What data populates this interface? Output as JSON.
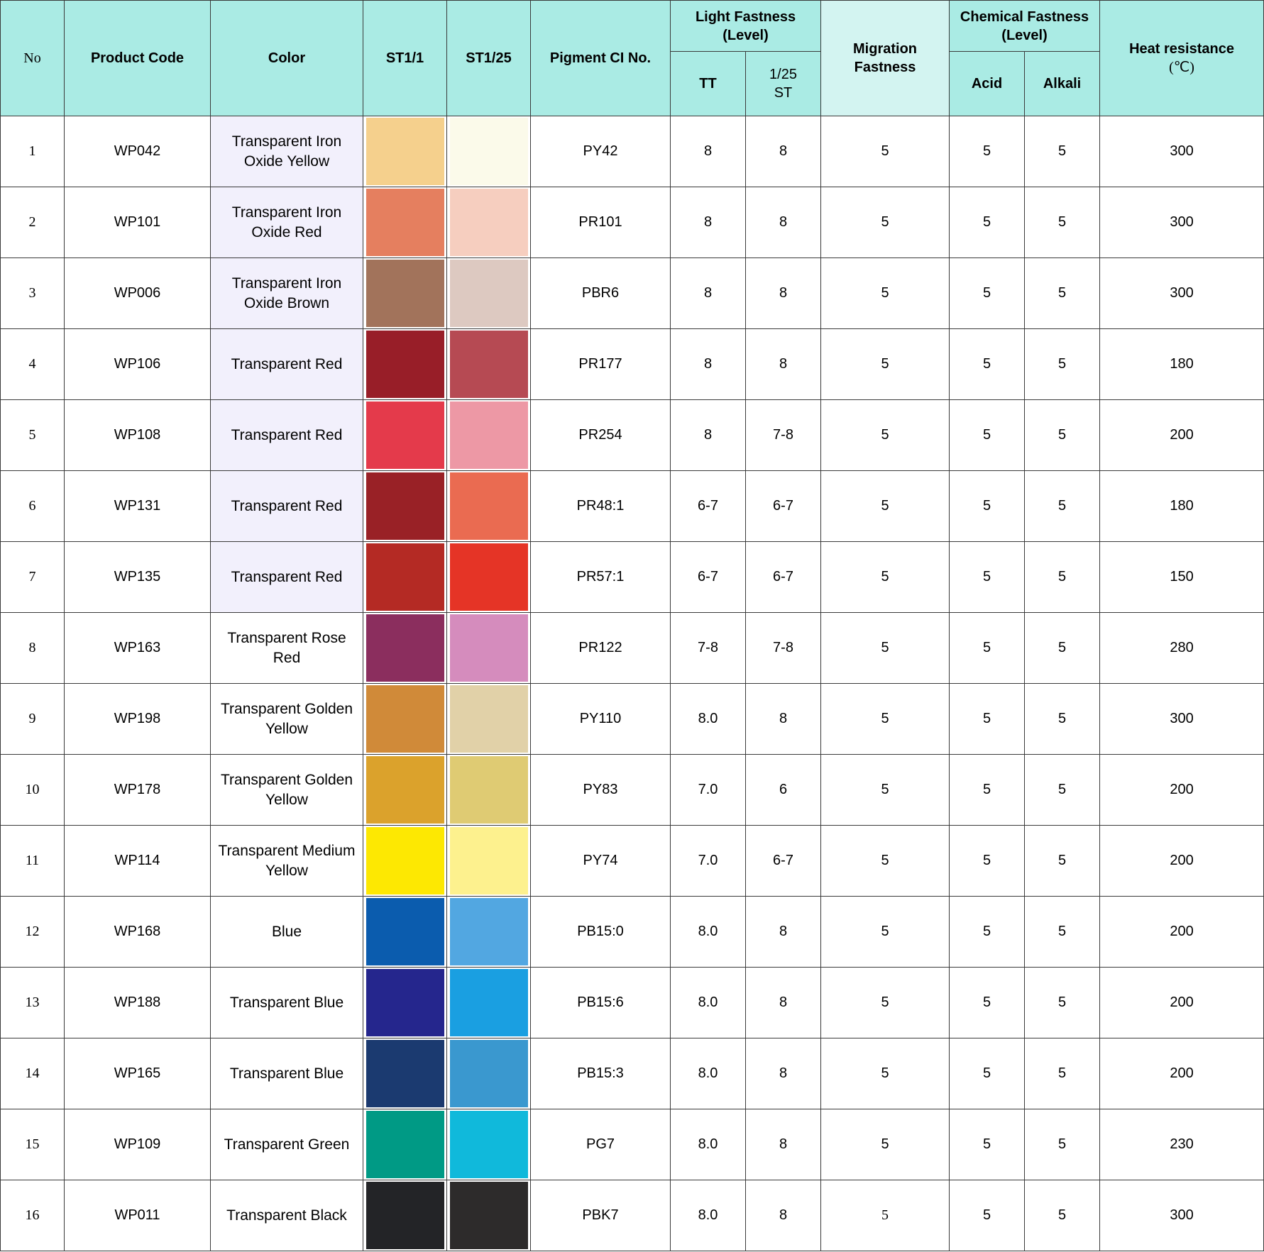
{
  "header": {
    "no": "No",
    "product_code": "Product Code",
    "color": "Color",
    "st1_1": "ST1/1",
    "st1_25": "ST1/25",
    "pigment_ci": "Pigment  CI No.",
    "light_fastness": [
      "Light Fastness",
      "(Level)"
    ],
    "tt": "TT",
    "st_125": [
      "1/25",
      "ST"
    ],
    "migration_fastness": [
      "Migration",
      "Fastness"
    ],
    "chemical_fastness": [
      "Chemical Fastness",
      "(Level)"
    ],
    "acid": "Acid",
    "alkali": "Alkali",
    "heat_resistance": [
      "Heat resistance",
      "(℃)"
    ]
  },
  "rows": [
    {
      "no": "1",
      "code": "WP042",
      "color": [
        "Transparent Iron",
        "Oxide Yellow"
      ],
      "swatch_full": "#f5d08d",
      "swatch_tint": "#fbfaea",
      "ci": "PY42",
      "tt": "8",
      "st": "8",
      "migration": "5",
      "acid": "5",
      "alkali": "5",
      "heat": "300"
    },
    {
      "no": "2",
      "code": "WP101",
      "color": [
        "Transparent Iron",
        "Oxide Red"
      ],
      "swatch_full": "#e57f5f",
      "swatch_tint": "#f6cebf",
      "ci": "PR101",
      "tt": "8",
      "st": "8",
      "migration": "5",
      "acid": "5",
      "alkali": "5",
      "heat": "300"
    },
    {
      "no": "3",
      "code": "WP006",
      "color": [
        "Transparent Iron",
        "Oxide Brown"
      ],
      "swatch_full": "#a2735b",
      "swatch_tint": "#ddc9c1",
      "ci": "PBR6",
      "tt": "8",
      "st": "8",
      "migration": "5",
      "acid": "5",
      "alkali": "5",
      "heat": "300"
    },
    {
      "no": "4",
      "code": "WP106",
      "color": [
        "Transparent Red"
      ],
      "swatch_full": "#981e28",
      "swatch_tint": "#b64a53",
      "ci": "PR177",
      "tt": "8",
      "st": "8",
      "migration": "5",
      "acid": "5",
      "alkali": "5",
      "heat": "180"
    },
    {
      "no": "5",
      "code": "WP108",
      "color": [
        "Transparent Red"
      ],
      "swatch_full": "#e43a4b",
      "swatch_tint": "#ed98a5",
      "ci": "PR254",
      "tt": "8",
      "st": "7-8",
      "migration": "5",
      "acid": "5",
      "alkali": "5",
      "heat": "200"
    },
    {
      "no": "6",
      "code": "WP131",
      "color": [
        "Transparent Red"
      ],
      "swatch_full": "#992126",
      "swatch_tint": "#ea6b51",
      "ci": "PR48:1",
      "tt": "6-7",
      "st": "6-7",
      "migration": "5",
      "acid": "5",
      "alkali": "5",
      "heat": "180"
    },
    {
      "no": "7",
      "code": "WP135",
      "color": [
        "Transparent Red"
      ],
      "swatch_full": "#b42a24",
      "swatch_tint": "#e53426",
      "ci": "PR57:1",
      "tt": "6-7",
      "st": "6-7",
      "migration": "5",
      "acid": "5",
      "alkali": "5",
      "heat": "150"
    },
    {
      "no": "8",
      "code": "WP163",
      "color": [
        "Transparent Rose",
        "Red"
      ],
      "swatch_full": "#8b2e5e",
      "swatch_tint": "#d58cbd",
      "ci": "PR122",
      "tt": "7-8",
      "st": "7-8",
      "migration": "5",
      "acid": "5",
      "alkali": "5",
      "heat": "280"
    },
    {
      "no": "9",
      "code": "WP198",
      "color": [
        "Transparent Golden",
        "Yellow"
      ],
      "swatch_full": "#d08a39",
      "swatch_tint": "#e1d1a8",
      "ci": "PY110",
      "tt": "8.0",
      "st": "8",
      "migration": "5",
      "acid": "5",
      "alkali": "5",
      "heat": "300"
    },
    {
      "no": "10",
      "code": "WP178",
      "color": [
        "Transparent Golden",
        "Yellow"
      ],
      "swatch_full": "#dba22c",
      "swatch_tint": "#dfcb73",
      "ci": "PY83",
      "tt": "7.0",
      "st": "6",
      "migration": "5",
      "acid": "5",
      "alkali": "5",
      "heat": "200"
    },
    {
      "no": "11",
      "code": "WP114",
      "color": [
        "Transparent Medium",
        "Yellow"
      ],
      "swatch_full": "#fde802",
      "swatch_tint": "#fdf18e",
      "ci": "PY74",
      "tt": "7.0",
      "st": "6-7",
      "migration": "5",
      "acid": "5",
      "alkali": "5",
      "heat": "200"
    },
    {
      "no": "12",
      "code": "WP168",
      "color": [
        "Blue"
      ],
      "swatch_full": "#0b5cae",
      "swatch_tint": "#52a7e1",
      "ci": "PB15:0",
      "tt": "8.0",
      "st": "8",
      "migration": "5",
      "acid": "5",
      "alkali": "5",
      "heat": "200"
    },
    {
      "no": "13",
      "code": "WP188",
      "color": [
        "Transparent Blue"
      ],
      "swatch_full": "#25268d",
      "swatch_tint": "#1a9fe1",
      "ci": "PB15:6",
      "tt": "8.0",
      "st": "8",
      "migration": "5",
      "acid": "5",
      "alkali": "5",
      "heat": "200"
    },
    {
      "no": "14",
      "code": "WP165",
      "color": [
        "Transparent Blue"
      ],
      "swatch_full": "#1b3a70",
      "swatch_tint": "#3a98cf",
      "ci": "PB15:3",
      "tt": "8.0",
      "st": "8",
      "migration": "5",
      "acid": "5",
      "alkali": "5",
      "heat": "200"
    },
    {
      "no": "15",
      "code": "WP109",
      "color": [
        "Transparent Green"
      ],
      "swatch_full": "#009a85",
      "swatch_tint": "#10b9db",
      "ci": "PG7",
      "tt": "8.0",
      "st": "8",
      "migration": "5",
      "acid": "5",
      "alkali": "5",
      "heat": "230"
    },
    {
      "no": "16",
      "code": "WP011",
      "color": [
        "Transparent Black"
      ],
      "swatch_full": "#232427",
      "swatch_tint": "#2d2b2b",
      "ci": "PBK7",
      "tt": "8.0",
      "st": "8",
      "migration": "5",
      "acid": "5",
      "alkali": "5",
      "heat": "300"
    }
  ]
}
